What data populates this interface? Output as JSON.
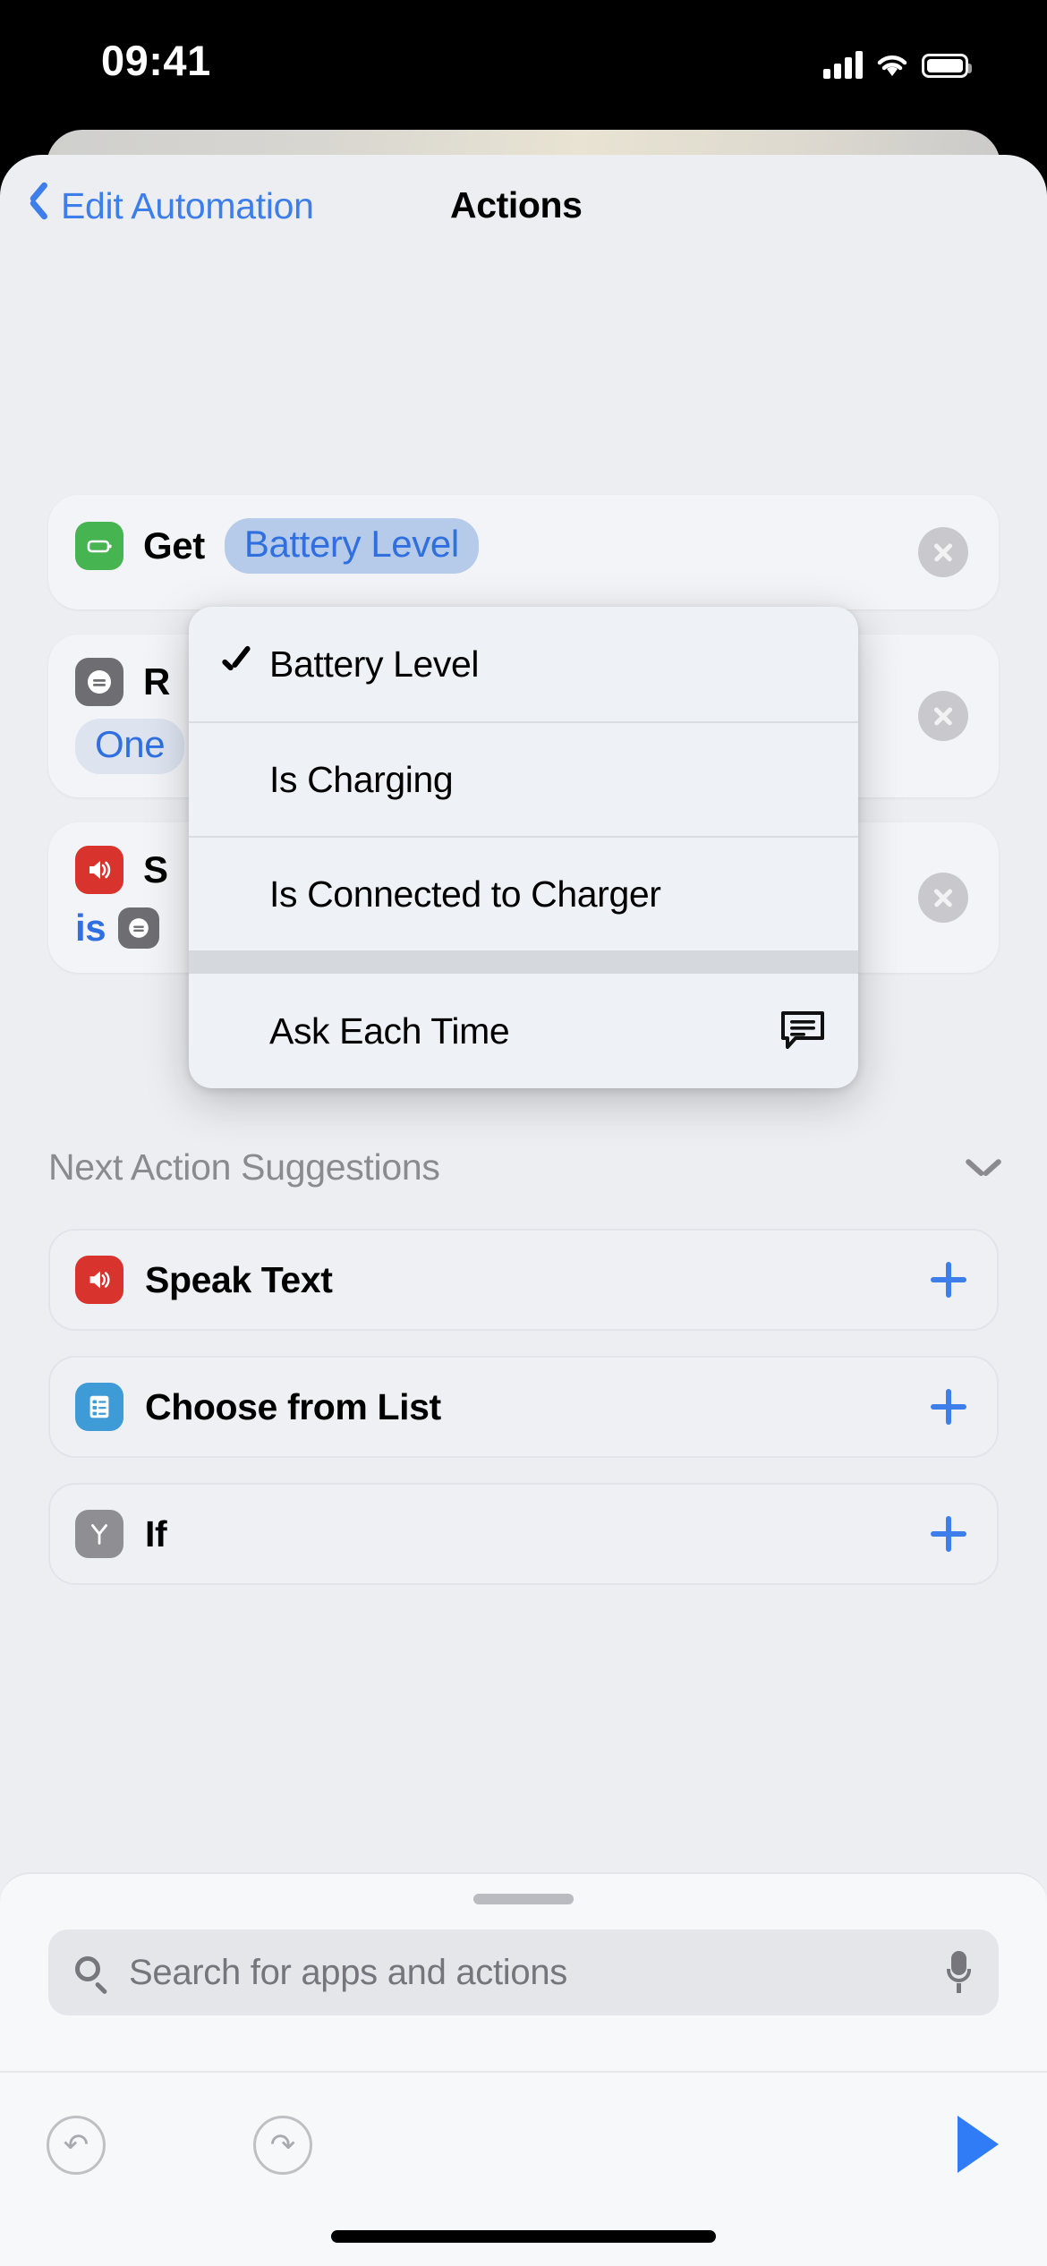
{
  "status_bar": {
    "time": "09:41",
    "cellular_icon": "cellular-signal-icon",
    "wifi_icon": "wifi-icon",
    "battery_icon": "battery-icon"
  },
  "nav": {
    "back_label": "Edit Automation",
    "back_icon": "chevron-left-icon",
    "title": "Actions"
  },
  "actions": [
    {
      "icon": "battery-icon",
      "icon_color": "#46b450",
      "prefix": "Get",
      "token": "Battery Level",
      "token_selected": true,
      "line2_prefix": "",
      "line2_token": "",
      "close_icon": "close-circle-icon"
    },
    {
      "icon": "equals-circle-icon",
      "icon_color": "#6d6d72",
      "prefix": "R",
      "token": "",
      "token_selected": false,
      "line2_prefix": "One",
      "line2_token": "",
      "close_icon": "close-circle-icon"
    },
    {
      "icon": "speaker-icon",
      "icon_color": "#d8332c",
      "prefix": "S",
      "token": "",
      "token_selected": false,
      "line2_prefix": "is",
      "line2_token": "equals-circle-icon",
      "close_icon": "close-circle-icon"
    }
  ],
  "menu": {
    "items": [
      {
        "label": "Battery Level",
        "checked": true,
        "trailing_icon": ""
      },
      {
        "label": "Is Charging",
        "checked": false,
        "trailing_icon": ""
      },
      {
        "label": "Is Connected to Charger",
        "checked": false,
        "trailing_icon": ""
      },
      {
        "label": "Ask Each Time",
        "checked": false,
        "trailing_icon": "speech-bubble-icon"
      }
    ]
  },
  "suggestions": {
    "header": "Next Action Suggestions",
    "collapse_icon": "chevron-down-icon",
    "items": [
      {
        "label": "Speak Text",
        "icon": "speaker-icon",
        "icon_color": "#d8332c",
        "add_icon": "plus-icon"
      },
      {
        "label": "Choose from List",
        "icon": "list-icon",
        "icon_color": "#3e9bd6",
        "add_icon": "plus-icon"
      },
      {
        "label": "If",
        "icon": "branch-icon",
        "icon_color": "#8e8e93",
        "add_icon": "plus-icon"
      }
    ]
  },
  "search": {
    "placeholder": "Search for apps and actions",
    "search_icon": "search-icon",
    "mic_icon": "microphone-icon",
    "grabber": "sheet-grabber"
  },
  "toolbar": {
    "undo_icon": "undo-icon",
    "undo_glyph": "↶",
    "redo_icon": "redo-icon",
    "redo_glyph": "↷",
    "run_icon": "play-icon"
  },
  "colors": {
    "accent_blue": "#3d7eeb",
    "token_blue": "#2f6fe0",
    "token_bg": "#b6cbea",
    "sheet_bg": "#eceef2",
    "menu_bg": "#eef1f5"
  }
}
